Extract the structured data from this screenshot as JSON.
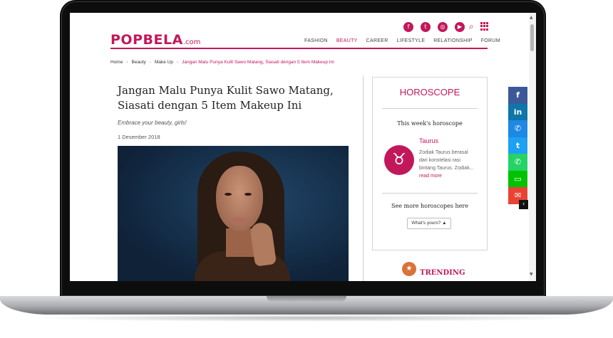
{
  "site": {
    "logo": "POPBELA",
    "logo_suffix": ".com",
    "brand_color": "#c2185b"
  },
  "header": {
    "social_icons": [
      {
        "icon": "facebook-icon",
        "glyph": "f"
      },
      {
        "icon": "twitter-icon",
        "glyph": "t"
      },
      {
        "icon": "instagram-icon",
        "glyph": "◎"
      },
      {
        "icon": "youtube-icon",
        "glyph": "▶"
      }
    ],
    "search_glyph": "⌕",
    "nav": [
      "FASHION",
      "BEAUTY",
      "CAREER",
      "LIFESTYLE",
      "RELATIONSHIP",
      "FORUM"
    ],
    "active_nav": "BEAUTY"
  },
  "breadcrumb": {
    "items": [
      "Home",
      "Beauty",
      "Make Up"
    ],
    "current": "Jangan Malu Punya Kulit Sawo Matang, Siasati dengan 5 Item Makeup Ini",
    "separator": "›"
  },
  "article": {
    "title": "Jangan Malu Punya Kulit Sawo Matang, Siasati dengan 5 Item Makeup Ini",
    "subtitle": "Embrace your beauty, girls!",
    "date": "1 Desember 2018"
  },
  "sidebar": {
    "horoscope_title": "HOROSCOPE",
    "week_label": "This week's horoscope",
    "sign_name": "Taurus",
    "sign_glyph": "♉",
    "sign_desc": "Zodiak Taurus berasal dari konstelasi rasi bintang Taurus. Zodiak...",
    "read_more": "read more",
    "see_more": "See more horoscopes here",
    "select_value": "What's yours?",
    "select_caret": "▲",
    "trending_label": "TRENDING",
    "trending_glyph": "★"
  },
  "share_bar": [
    {
      "name": "facebook-share",
      "glyph": "f",
      "color": "#3b5998"
    },
    {
      "name": "linkedin-share",
      "glyph": "in",
      "color": "#0e76a8"
    },
    {
      "name": "messenger-share",
      "glyph": "✆",
      "color": "#1e88e5"
    },
    {
      "name": "twitter-share",
      "glyph": "t",
      "color": "#1da1f2"
    },
    {
      "name": "whatsapp-share",
      "glyph": "✆",
      "color": "#25d366"
    },
    {
      "name": "line-share",
      "glyph": "▭",
      "color": "#00c300"
    },
    {
      "name": "email-share",
      "glyph": "✉",
      "color": "#ea4335"
    }
  ],
  "share_collapse_glyph": "‹",
  "scrollbar": {
    "up": "▲",
    "down": "▼"
  }
}
